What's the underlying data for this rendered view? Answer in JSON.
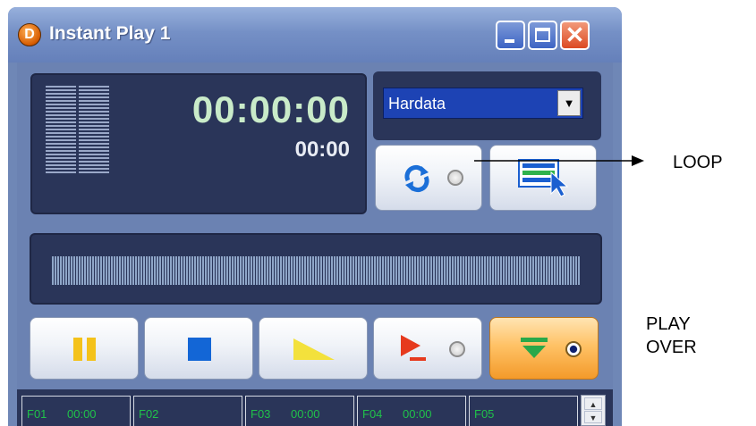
{
  "window": {
    "title": "Instant Play 1",
    "icon_letter": "D"
  },
  "titlebar_buttons": [
    "minimize-icon",
    "maximize-icon",
    "close-icon"
  ],
  "titlebar_glyphs": {
    "close": "✕"
  },
  "display": {
    "time_main": "00:00:00",
    "time_sub": "00:00"
  },
  "source_select": {
    "value": "Hardata",
    "arrow": "▼"
  },
  "buttons": {
    "loop": {
      "icon": "loop-arrows-icon",
      "radio_on": false
    },
    "select": {
      "icon": "list-pointer-icon"
    }
  },
  "transport": [
    {
      "name": "pause",
      "icon": "pause-icon"
    },
    {
      "name": "stop",
      "icon": "stop-icon"
    },
    {
      "name": "play",
      "icon": "play-ramp-icon"
    },
    {
      "name": "play-over",
      "icon": "play-over-icon",
      "radio_on": false
    },
    {
      "name": "hold",
      "icon": "hold-icon",
      "radio_on": true,
      "active_color": "#f7a334"
    }
  ],
  "function_keys": [
    {
      "key": "F01",
      "time": "00:00"
    },
    {
      "key": "F02",
      "time": ""
    },
    {
      "key": "F03",
      "time": "00:00"
    },
    {
      "key": "F04",
      "time": "00:00"
    },
    {
      "key": "F05",
      "time": ""
    }
  ],
  "scroll": {
    "up": "▲",
    "down": "▼"
  },
  "annotations": {
    "loop_label": "LOOP",
    "playover_line1": "PLAY",
    "playover_line2": "OVER"
  },
  "colors": {
    "panel": "#2a3559",
    "time_main": "#c9ebc9",
    "fkey_text": "#20c24a"
  }
}
